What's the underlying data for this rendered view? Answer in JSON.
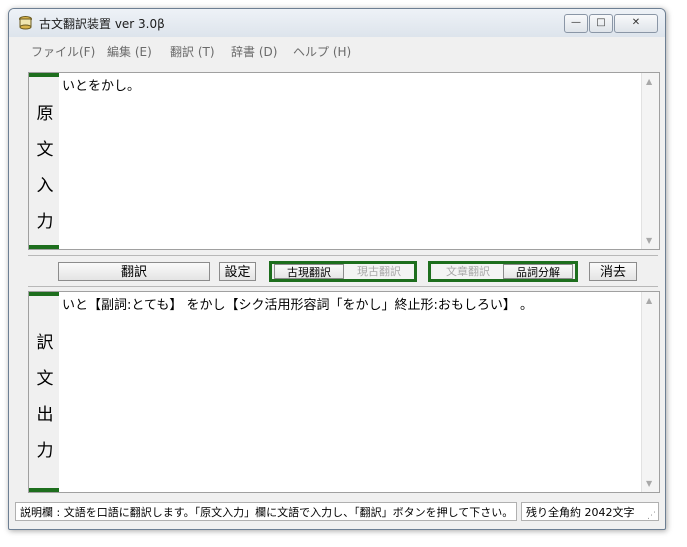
{
  "window": {
    "title": "古文翻訳装置 ver 3.0β",
    "min_glyph": "—",
    "max_glyph": "□",
    "close_glyph": "✕"
  },
  "menu": [
    {
      "label": "ファイル(F)"
    },
    {
      "label": "編集 (E)"
    },
    {
      "label": "翻訳 (T)"
    },
    {
      "label": "辞書 (D)"
    },
    {
      "label": "ヘルプ (H)"
    }
  ],
  "input_panel": {
    "side_label": [
      "原",
      "文",
      "入",
      "力"
    ],
    "text": "いとをかし。"
  },
  "toolbar": {
    "translate_label": "翻訳",
    "settings_label": "設定",
    "mode_group_1": [
      {
        "label": "古現翻訳",
        "active": true
      },
      {
        "label": "現古翻訳",
        "active": false
      }
    ],
    "mode_group_2": [
      {
        "label": "文章翻訳",
        "active": false
      },
      {
        "label": "品詞分解",
        "active": true
      }
    ],
    "clear_label": "消去"
  },
  "output_panel": {
    "side_label": [
      "訳",
      "文",
      "出",
      "力"
    ],
    "text": "いと【副詞:とても】 をかし【シク活用形容詞「をかし」終止形:おもしろい】 。"
  },
  "status": {
    "help_text": "説明欄 : 文語を口語に翻訳します。「原文入力」欄に文語で入力し、「翻訳」ボタンを押して下さい。",
    "remaining": "残り全角約 2042文字"
  },
  "colors": {
    "accent_green": "#1d6e1d"
  }
}
